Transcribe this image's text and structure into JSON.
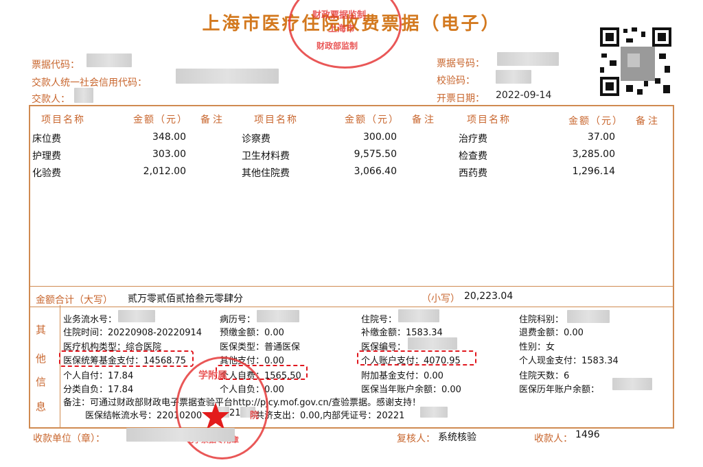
{
  "title": "上海市医疗住院收费票据（电子）",
  "header": {
    "code_label": "票据代码：",
    "credit_label": "交款人统一社会信用代码：",
    "payer_label": "交款人：",
    "number_label": "票据号码：",
    "check_label": "校验码：",
    "date_label": "开票日期：",
    "date_value": "2022-09-14"
  },
  "table": {
    "col_headers": [
      "项目名称",
      "金额（元）",
      "备注"
    ],
    "items": [
      {
        "name": "床位费",
        "amount": "348.00"
      },
      {
        "name": "护理费",
        "amount": "303.00"
      },
      {
        "name": "化验费",
        "amount": "2,012.00"
      },
      {
        "name": "诊察费",
        "amount": "300.00"
      },
      {
        "name": "卫生材料费",
        "amount": "9,575.50"
      },
      {
        "name": "其他住院费",
        "amount": "3,066.40"
      },
      {
        "name": "治疗费",
        "amount": "37.00"
      },
      {
        "name": "检查费",
        "amount": "3,285.00"
      },
      {
        "name": "西药费",
        "amount": "1,296.14"
      }
    ]
  },
  "total": {
    "daxie_label": "金额合计（大写）",
    "daxie_value": "贰万零贰佰贰拾叁元零肆分",
    "xiaoxie_label": "（小写）",
    "xiaoxie_value": "20,223.04"
  },
  "other_info": {
    "side_label": [
      "其",
      "他",
      "信",
      "息"
    ],
    "col1": [
      "业务流水号：",
      "住院时间：20220908-20220914",
      "医疗机构类型：综合医院",
      "医保统筹基金支付：14568.75",
      "个人自付：17.84",
      "分类自负：17.84"
    ],
    "col2": [
      "病历号：",
      "预缴金额：0.00",
      "医保类型：普通医保",
      "其他支付：0.00",
      "个人自费：1565.50",
      "个人自负：0.00"
    ],
    "col3": [
      "住院号：",
      "补缴金额：1583.34",
      "医保编号：",
      "个人账户支付：4070.95",
      "附加基金支付：0.00",
      "医保当年账户余额：0.00"
    ],
    "col4": [
      "住院科别：",
      "退费金额：0.00",
      "性别：女",
      "个人现金支付：1583.34",
      "住院天数：6",
      "医保历年账户余额："
    ],
    "remark": "备注：可通过财政部财政电子票据查验平台http://pjcy.mof.gov.cn/查验票据。感谢支持！",
    "settle_prefix": "医保结帐流水号：22010200",
    "settle_mid": "21",
    "settle_tail": "共济支出：0.00,内部凭证号：20221"
  },
  "footer": {
    "unit_label": "收款单位（章）：",
    "review_label": "复核人：",
    "review_value": "系统核验",
    "payee_label": "收款人：",
    "payee_value": "1496"
  },
  "stamps": {
    "top_lines": [
      "财政票据监制",
      "上海市",
      "财政部监制"
    ],
    "bottom_lines": [
      "学附属",
      "院",
      "电子票据专用章"
    ]
  },
  "colors": {
    "accent": "#c8662e",
    "stamp": "#e63a3a",
    "highlight": "#e0161d"
  }
}
